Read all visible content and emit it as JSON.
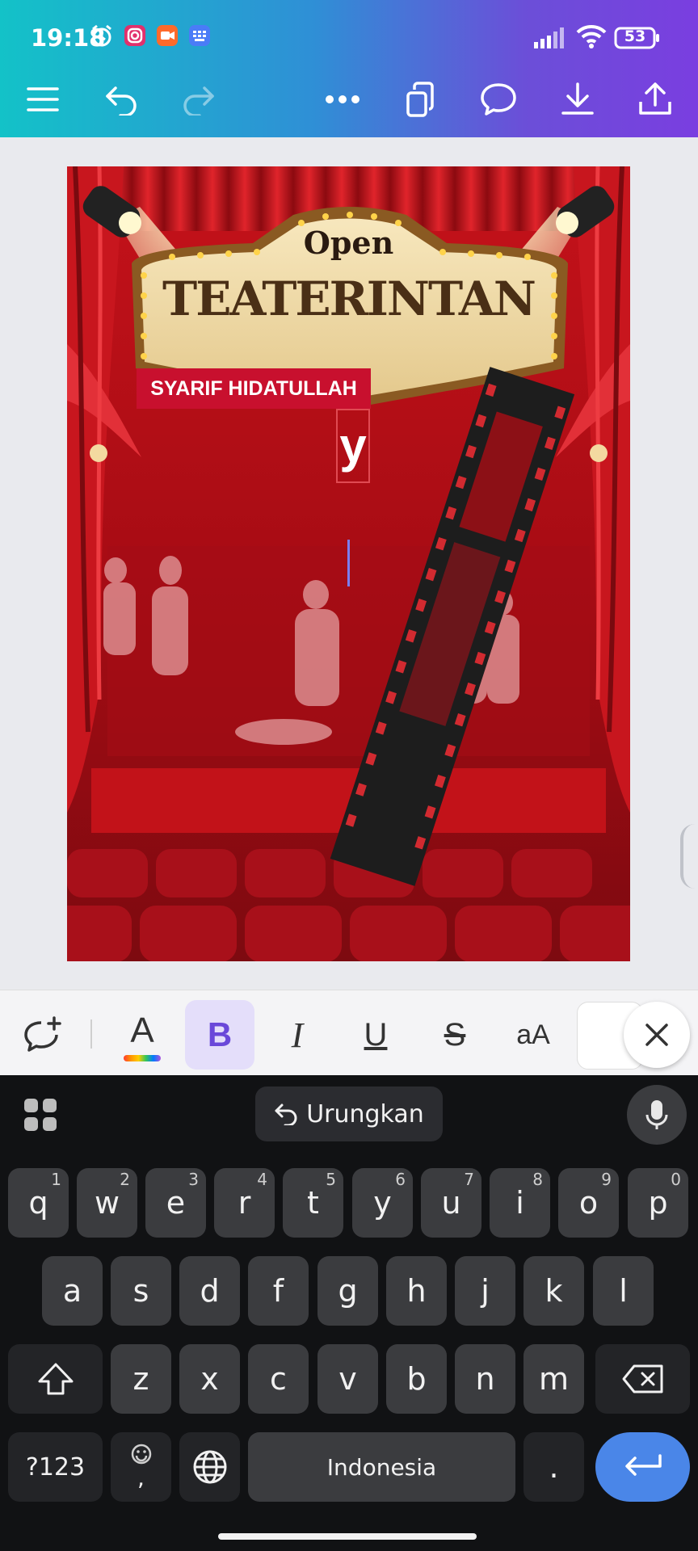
{
  "status_bar": {
    "time": "19:18",
    "battery": "53"
  },
  "toolbar": {
    "menu": "menu-icon",
    "undo": "undo-icon",
    "redo": "redo-icon",
    "more": "more-icon",
    "pages": "pages-icon",
    "comment": "comment-icon",
    "download": "download-icon",
    "share": "share-icon"
  },
  "poster": {
    "sign_top": "Open",
    "sign_title": "TEATERINTAN",
    "name_label": "SYARIF HIDATULLAH",
    "typed_text": "y"
  },
  "format_bar": {
    "bold": "B",
    "italic": "I",
    "underline": "U",
    "strike": "S",
    "case": "aA",
    "color_letter": "A"
  },
  "keyboard": {
    "undo_label": "Urungkan",
    "row1": [
      {
        "k": "q",
        "n": "1"
      },
      {
        "k": "w",
        "n": "2"
      },
      {
        "k": "e",
        "n": "3"
      },
      {
        "k": "r",
        "n": "4"
      },
      {
        "k": "t",
        "n": "5"
      },
      {
        "k": "y",
        "n": "6"
      },
      {
        "k": "u",
        "n": "7"
      },
      {
        "k": "i",
        "n": "8"
      },
      {
        "k": "o",
        "n": "9"
      },
      {
        "k": "p",
        "n": "0"
      }
    ],
    "row2": [
      "a",
      "s",
      "d",
      "f",
      "g",
      "h",
      "j",
      "k",
      "l"
    ],
    "row3": [
      "z",
      "x",
      "c",
      "v",
      "b",
      "n",
      "m"
    ],
    "symbols": "?123",
    "emoji_comma": ",",
    "space": "Indonesia",
    "period": "."
  }
}
